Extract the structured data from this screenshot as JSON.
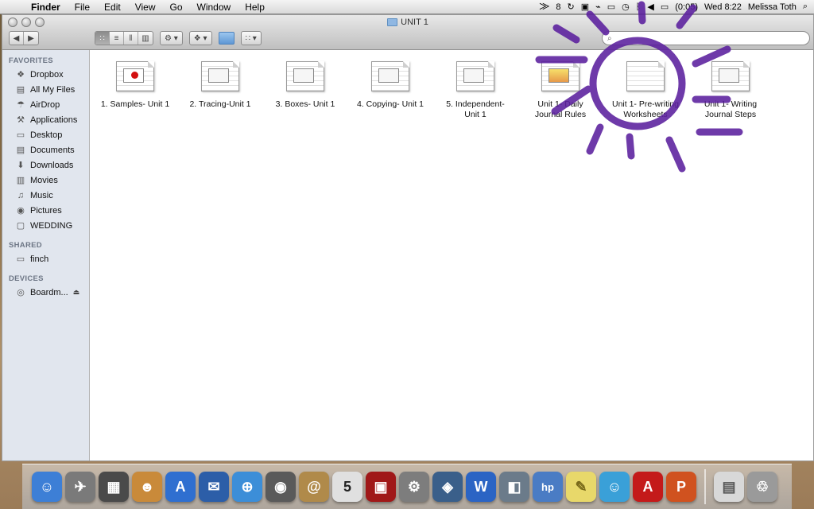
{
  "menubar": {
    "app_name": "Finder",
    "menus": [
      "File",
      "Edit",
      "View",
      "Go",
      "Window",
      "Help"
    ],
    "status_badge": "8",
    "battery": "(0:05)",
    "clock": "Wed 8:22",
    "user": "Melissa Toth"
  },
  "window": {
    "title": "UNIT 1",
    "search_placeholder": ""
  },
  "sidebar": {
    "favorites_header": "FAVORITES",
    "favorites": [
      {
        "label": "Dropbox",
        "icon": "dropbox-icon"
      },
      {
        "label": "All My Files",
        "icon": "all-files-icon"
      },
      {
        "label": "AirDrop",
        "icon": "airdrop-icon"
      },
      {
        "label": "Applications",
        "icon": "applications-icon"
      },
      {
        "label": "Desktop",
        "icon": "desktop-icon"
      },
      {
        "label": "Documents",
        "icon": "documents-icon"
      },
      {
        "label": "Downloads",
        "icon": "downloads-icon"
      },
      {
        "label": "Movies",
        "icon": "movies-icon"
      },
      {
        "label": "Music",
        "icon": "music-icon"
      },
      {
        "label": "Pictures",
        "icon": "pictures-icon"
      },
      {
        "label": "WEDDING",
        "icon": "folder-icon"
      }
    ],
    "shared_header": "SHARED",
    "shared": [
      {
        "label": "finch",
        "icon": "computer-icon"
      }
    ],
    "devices_header": "DEVICES",
    "devices": [
      {
        "label": "Boardm...",
        "icon": "disk-icon"
      }
    ]
  },
  "files": [
    {
      "label_line1": "1.  Samples- Unit 1",
      "label_line2": "",
      "thumb": "apple"
    },
    {
      "label_line1": "2.  Tracing-Unit 1",
      "label_line2": "",
      "thumb": "plain"
    },
    {
      "label_line1": "3.  Boxes- Unit 1",
      "label_line2": "",
      "thumb": "plain"
    },
    {
      "label_line1": "4.  Copying- Unit 1",
      "label_line2": "",
      "thumb": "plain"
    },
    {
      "label_line1": "5.  Independent-",
      "label_line2": "Unit 1",
      "thumb": "plain"
    },
    {
      "label_line1": "Unit 1- Daily",
      "label_line2": "Journal Rules",
      "thumb": "kid"
    },
    {
      "label_line1": "Unit 1- Pre-writing",
      "label_line2": "Worksheets",
      "thumb": "plain"
    },
    {
      "label_line1": "Unit 1- Writing",
      "label_line2": "Journal Steps",
      "thumb": "plain"
    }
  ],
  "dock": {
    "apps": [
      {
        "name": "finder",
        "color": "#3d7fd6",
        "glyph": "☺"
      },
      {
        "name": "launchpad",
        "color": "#7a7a7a",
        "glyph": "✈"
      },
      {
        "name": "mission-control",
        "color": "#4a4a4a",
        "glyph": "▦"
      },
      {
        "name": "photo-booth",
        "color": "#c98a3a",
        "glyph": "☻"
      },
      {
        "name": "app-store",
        "color": "#2f6fd0",
        "glyph": "A"
      },
      {
        "name": "mail-eagle",
        "color": "#2c5ea8",
        "glyph": "✉"
      },
      {
        "name": "safari",
        "color": "#3c8ed8",
        "glyph": "⊕"
      },
      {
        "name": "facetime",
        "color": "#5a5a5a",
        "glyph": "◉"
      },
      {
        "name": "address-book",
        "color": "#b08a4a",
        "glyph": "@"
      },
      {
        "name": "calendar",
        "color": "#e0e0e0",
        "glyph": "5"
      },
      {
        "name": "photo-app",
        "color": "#a01818",
        "glyph": "▣"
      },
      {
        "name": "system-preferences",
        "color": "#7d7d7d",
        "glyph": "⚙"
      },
      {
        "name": "iphoto",
        "color": "#3a5f8a",
        "glyph": "◈"
      },
      {
        "name": "word",
        "color": "#2b64c4",
        "glyph": "W"
      },
      {
        "name": "preview",
        "color": "#6b7b8a",
        "glyph": "◧"
      },
      {
        "name": "hp-utility",
        "color": "#4a7cc4",
        "glyph": "hp"
      },
      {
        "name": "stickies",
        "color": "#e8d86a",
        "glyph": "✎"
      },
      {
        "name": "messenger",
        "color": "#3aa0d8",
        "glyph": "☺"
      },
      {
        "name": "acrobat",
        "color": "#c41a1a",
        "glyph": "A"
      },
      {
        "name": "powerpoint",
        "color": "#d0521f",
        "glyph": "P"
      },
      {
        "name": "downloads-stack",
        "color": "#d8d8d8",
        "glyph": "▤"
      },
      {
        "name": "trash",
        "color": "#9a9a9a",
        "glyph": "🗑"
      }
    ]
  }
}
